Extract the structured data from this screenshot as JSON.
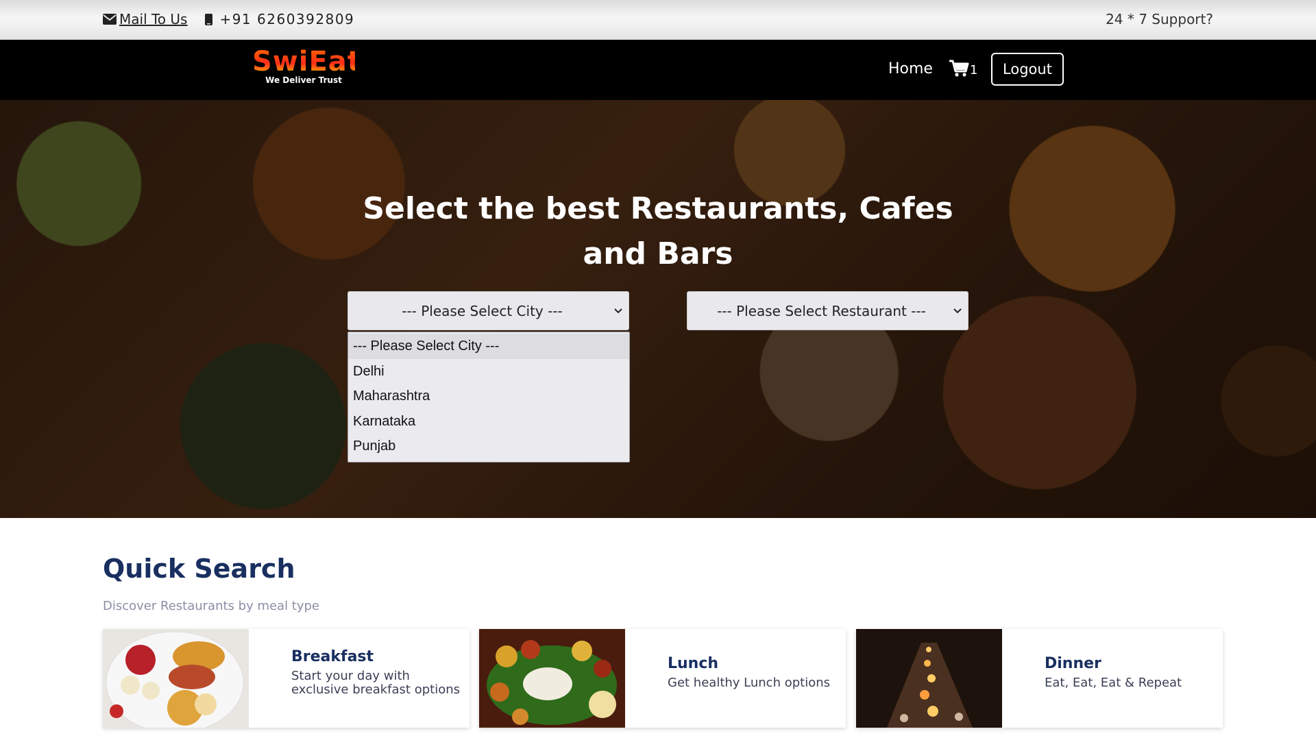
{
  "topbar": {
    "mail_label": "Mail To Us",
    "phone": "+91 6260392809",
    "support": "24 * 7 Support?"
  },
  "navbar": {
    "logo_text": "SwiEat",
    "logo_tagline": "We Deliver Trust",
    "home_label": "Home",
    "cart_count": "1",
    "logout_label": "Logout"
  },
  "hero": {
    "title": "Select the best Restaurants, Cafes and Bars",
    "city_select": {
      "selected": "--- Please Select City ---",
      "options": [
        "--- Please Select City ---",
        "Delhi",
        "Maharashtra",
        "Karnataka",
        "Punjab"
      ]
    },
    "restaurant_select": {
      "selected": "--- Please Select Restaurant ---"
    }
  },
  "quick_search": {
    "title": "Quick Search",
    "subtitle": "Discover Restaurants by meal type",
    "cards": [
      {
        "title": "Breakfast",
        "description": "Start your day with exclusive breakfast options"
      },
      {
        "title": "Lunch",
        "description": "Get healthy Lunch options"
      },
      {
        "title": "Dinner",
        "description": "Eat, Eat, Eat & Repeat"
      }
    ]
  },
  "icons": [
    "envelope-icon",
    "mobile-phone-icon",
    "cart-icon",
    "chevron-down-icon"
  ]
}
